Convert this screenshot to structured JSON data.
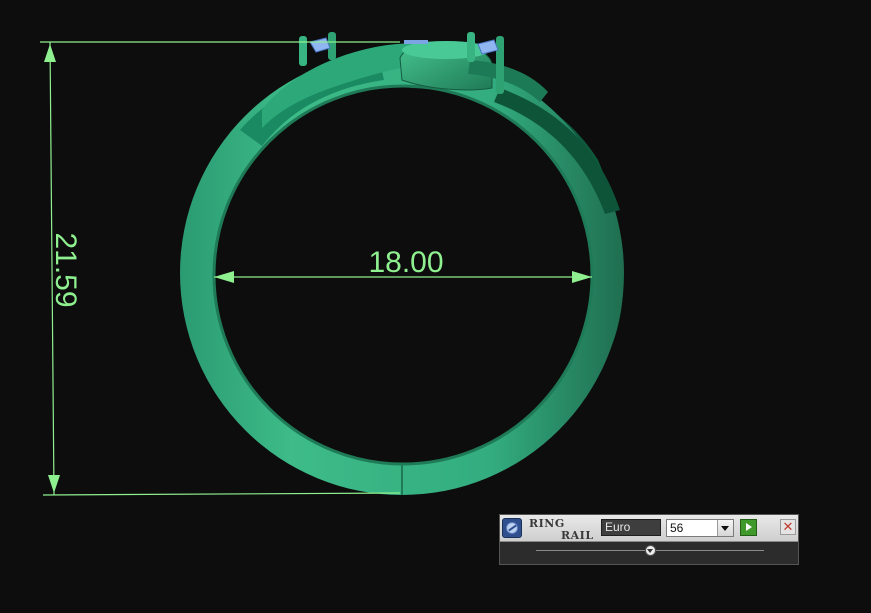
{
  "viewport": {
    "dimension_diameter": "18.00",
    "dimension_height": "21.59",
    "dimension_color": "#8ff08f",
    "ring_color": "#35b383",
    "background_color": "#0d0d0d"
  },
  "ring_panel": {
    "brand_line_1": "RING",
    "brand_line_2": "RAIL",
    "unit_label": "Euro",
    "size_value": "56",
    "slider_position": 0.5,
    "icons": {
      "logo": "ringrail-logo-icon",
      "apply": "play-icon",
      "close": "close-icon",
      "dropdown": "chevron-down-icon",
      "thumb": "slider-thumb-icon"
    },
    "close_glyph": "✕"
  }
}
